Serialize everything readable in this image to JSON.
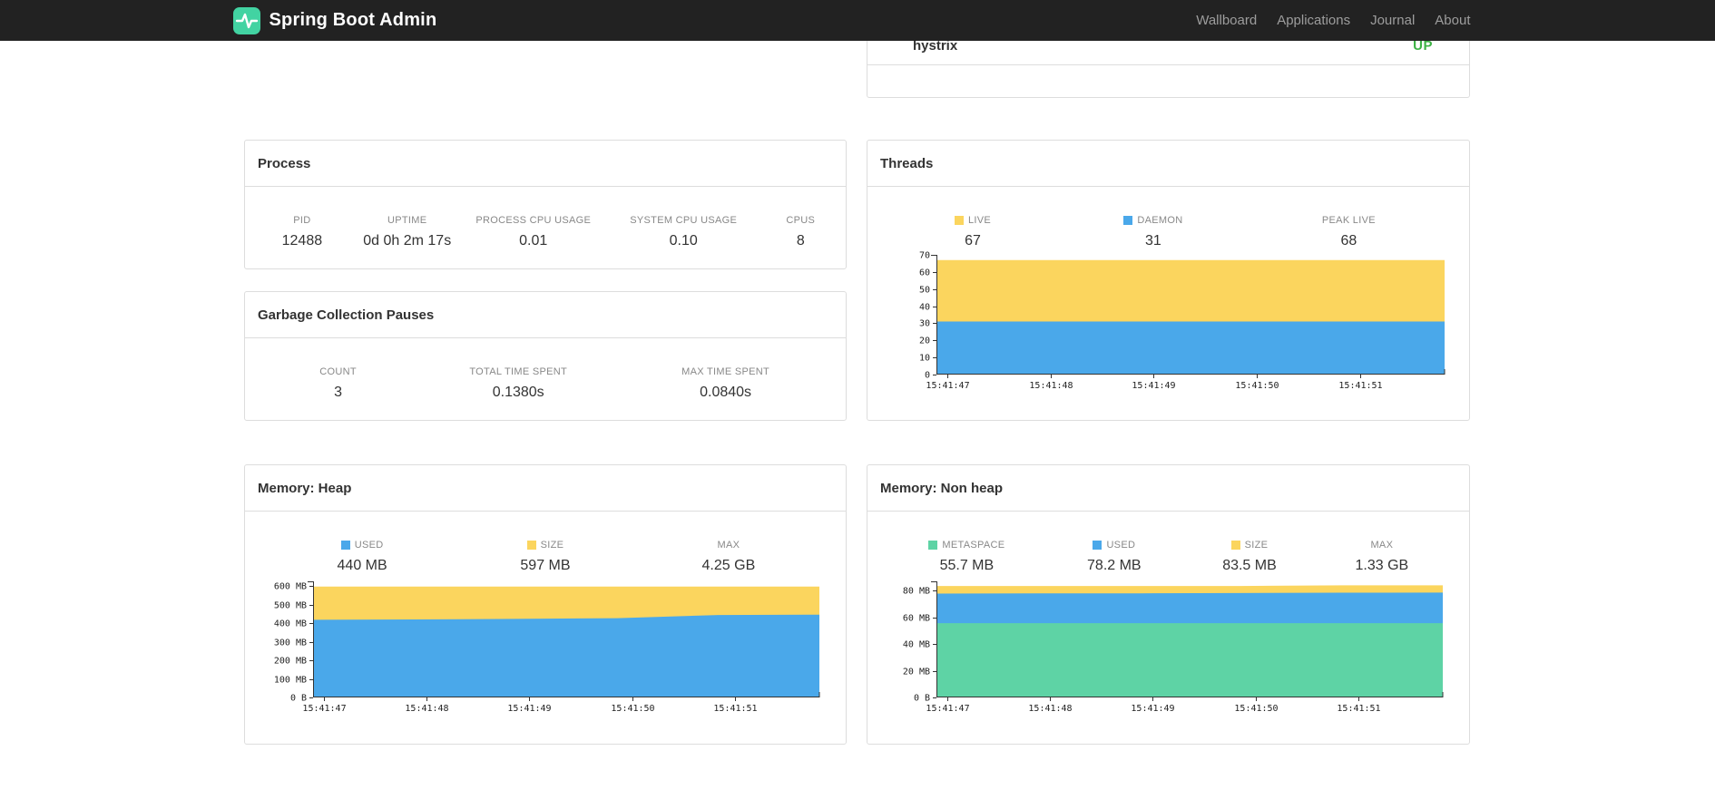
{
  "navbar": {
    "brand": "Spring Boot Admin",
    "links": [
      {
        "label": "Wallboard"
      },
      {
        "label": "Applications"
      },
      {
        "label": "Journal"
      },
      {
        "label": "About"
      }
    ]
  },
  "application_row": {
    "name": "hystrix",
    "status": "UP"
  },
  "colors": {
    "navbar_bg": "#222222",
    "brand_green": "#42d3a2",
    "status_up": "#3db245",
    "yellow": "#fbd55e",
    "blue": "#4aa8ea",
    "green": "#5ed3a5"
  },
  "panels": {
    "process": {
      "title": "Process",
      "stats": [
        {
          "label": "PID",
          "value": "12488"
        },
        {
          "label": "UPTIME",
          "value": "0d 0h 2m 17s"
        },
        {
          "label": "PROCESS CPU USAGE",
          "value": "0.01"
        },
        {
          "label": "SYSTEM CPU USAGE",
          "value": "0.10"
        },
        {
          "label": "CPUS",
          "value": "8"
        }
      ]
    },
    "gc": {
      "title": "Garbage Collection Pauses",
      "stats": [
        {
          "label": "COUNT",
          "value": "3"
        },
        {
          "label": "TOTAL TIME SPENT",
          "value": "0.1380s"
        },
        {
          "label": "MAX TIME SPENT",
          "value": "0.0840s"
        }
      ]
    },
    "threads": {
      "title": "Threads",
      "stats": [
        {
          "label": "LIVE",
          "value": "67",
          "color": "#fbd55e"
        },
        {
          "label": "DAEMON",
          "value": "31",
          "color": "#4aa8ea"
        },
        {
          "label": "PEAK LIVE",
          "value": "68"
        }
      ]
    },
    "heap": {
      "title": "Memory: Heap",
      "stats": [
        {
          "label": "USED",
          "value": "440 MB",
          "color": "#4aa8ea"
        },
        {
          "label": "SIZE",
          "value": "597 MB",
          "color": "#fbd55e"
        },
        {
          "label": "MAX",
          "value": "4.25 GB"
        }
      ]
    },
    "nonheap": {
      "title": "Memory: Non heap",
      "stats": [
        {
          "label": "METASPACE",
          "value": "55.7 MB",
          "color": "#5ed3a5"
        },
        {
          "label": "USED",
          "value": "78.2 MB",
          "color": "#4aa8ea"
        },
        {
          "label": "SIZE",
          "value": "83.5 MB",
          "color": "#fbd55e"
        },
        {
          "label": "MAX",
          "value": "1.33 GB"
        }
      ]
    }
  },
  "chart_data": [
    {
      "id": "threads-chart",
      "type": "area",
      "title": "Threads",
      "x_labels": [
        "15:41:47",
        "15:41:48",
        "15:41:49",
        "15:41:50",
        "15:41:51"
      ],
      "ylim": [
        0,
        70
      ],
      "y_ticks": [
        {
          "label": "70",
          "value": 70
        },
        {
          "label": "60",
          "value": 60
        },
        {
          "label": "50",
          "value": 50
        },
        {
          "label": "40",
          "value": 40
        },
        {
          "label": "30",
          "value": 30
        },
        {
          "label": "20",
          "value": 20
        },
        {
          "label": "10",
          "value": 10
        },
        {
          "label": "0",
          "value": 0
        }
      ],
      "legend": [
        "LIVE",
        "DAEMON",
        "PEAK LIVE"
      ],
      "grid": false,
      "series": [
        {
          "name": "LIVE",
          "color": "#fbd55e",
          "values": [
            67,
            67,
            67,
            67,
            67,
            67
          ]
        },
        {
          "name": "DAEMON",
          "color": "#4aa8ea",
          "values": [
            31,
            31,
            31,
            31,
            31,
            31
          ]
        }
      ]
    },
    {
      "id": "heap-chart",
      "type": "area",
      "title": "Memory: Heap",
      "x_labels": [
        "15:41:47",
        "15:41:48",
        "15:41:49",
        "15:41:50",
        "15:41:51"
      ],
      "ylim": [
        0,
        625
      ],
      "y_ticks": [
        {
          "label": "600 MB",
          "value": 600
        },
        {
          "label": "500 MB",
          "value": 500
        },
        {
          "label": "400 MB",
          "value": 400
        },
        {
          "label": "300 MB",
          "value": 300
        },
        {
          "label": "200 MB",
          "value": 200
        },
        {
          "label": "100 MB",
          "value": 100
        },
        {
          "label": "0 B",
          "value": 0
        }
      ],
      "legend": [
        "USED",
        "SIZE",
        "MAX"
      ],
      "grid": false,
      "series": [
        {
          "name": "SIZE",
          "color": "#fbd55e",
          "values": [
            597,
            597,
            597,
            597,
            597,
            597
          ]
        },
        {
          "name": "USED",
          "color": "#4aa8ea",
          "values": [
            418,
            420,
            423,
            427,
            444,
            446
          ]
        }
      ]
    },
    {
      "id": "nonheap-chart",
      "type": "area",
      "title": "Memory: Non heap",
      "x_labels": [
        "15:41:47",
        "15:41:48",
        "15:41:49",
        "15:41:50",
        "15:41:51"
      ],
      "ylim": [
        0,
        87
      ],
      "y_ticks": [
        {
          "label": "80 MB",
          "value": 80
        },
        {
          "label": "60 MB",
          "value": 60
        },
        {
          "label": "40 MB",
          "value": 40
        },
        {
          "label": "20 MB",
          "value": 20
        },
        {
          "label": "0 B",
          "value": 0
        }
      ],
      "legend": [
        "METASPACE",
        "USED",
        "SIZE",
        "MAX"
      ],
      "grid": false,
      "series": [
        {
          "name": "SIZE",
          "color": "#fbd55e",
          "values": [
            83.5,
            83.5,
            83.5,
            83.5,
            84,
            84
          ]
        },
        {
          "name": "USED",
          "color": "#4aa8ea",
          "values": [
            77.8,
            78,
            78,
            78.2,
            78.5,
            78.6
          ]
        },
        {
          "name": "METASPACE",
          "color": "#5ed3a5",
          "values": [
            55.7,
            55.7,
            55.7,
            55.7,
            55.7,
            55.7
          ]
        }
      ]
    }
  ]
}
